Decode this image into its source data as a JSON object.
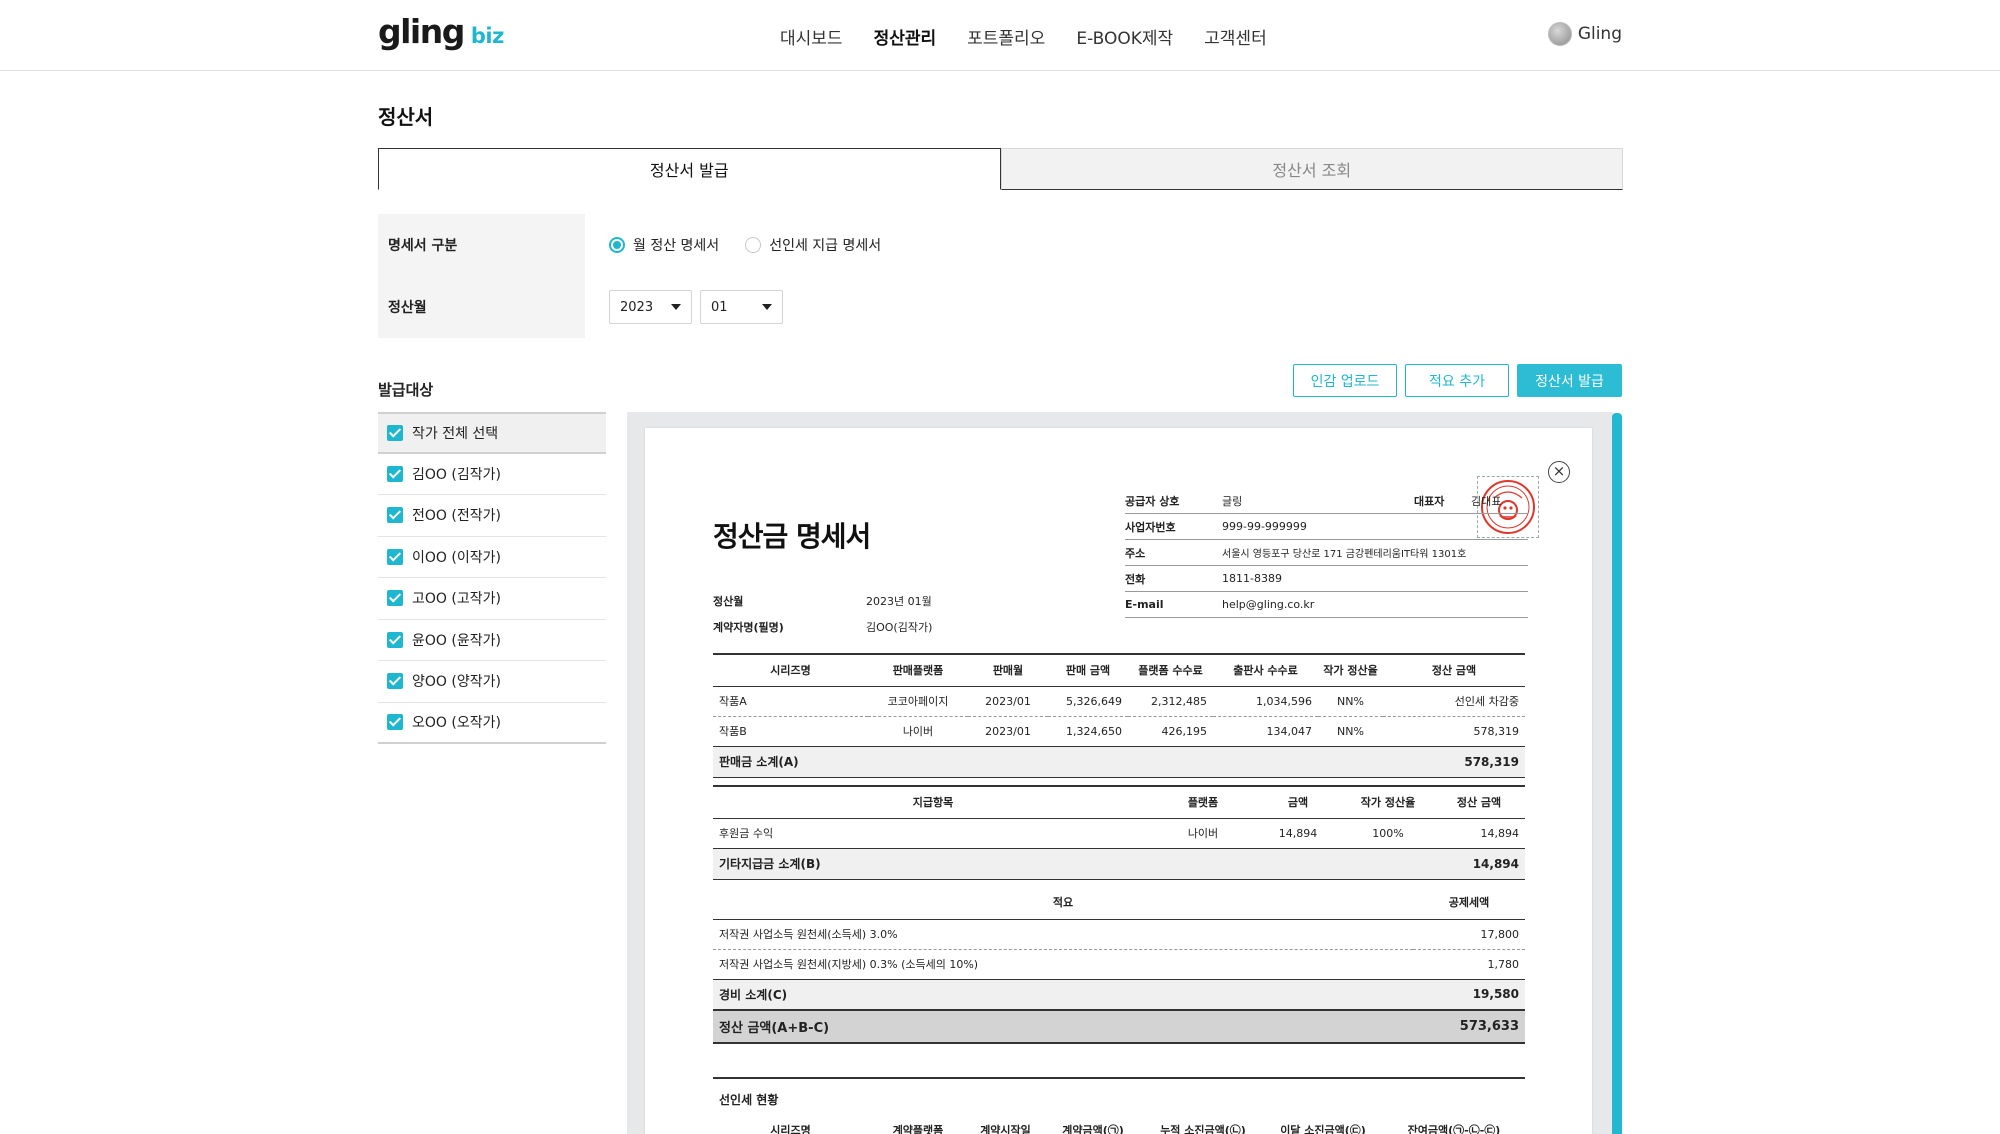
{
  "header": {
    "logo_main": "gling",
    "logo_sub": "biz",
    "nav": [
      "대시보드",
      "정산관리",
      "포트폴리오",
      "E-BOOK제작",
      "고객센터"
    ],
    "active_nav": "정산관리",
    "user_name": "Gling"
  },
  "page": {
    "title": "정산서",
    "tabs": [
      "정산서 발급",
      "정산서 조회"
    ],
    "active_tab": "정산서 발급"
  },
  "form": {
    "type_label": "명세서 구분",
    "type_options": [
      "월 정산 명세서",
      "선인세 지급 명세서"
    ],
    "type_selected": "월 정산 명세서",
    "month_label": "정산월",
    "year": "2023",
    "month": "01"
  },
  "targets": {
    "label": "발급대상",
    "select_all": "작가 전체 선택",
    "authors": [
      "김OO (김작가)",
      "전OO (전작가)",
      "이OO (이작가)",
      "고OO (고작가)",
      "윤OO (윤작가)",
      "양OO (양작가)",
      "오OO (오작가)"
    ]
  },
  "actions": {
    "upload_stamp": "인감 업로드",
    "add_note": "적요 추가",
    "issue": "정산서 발급"
  },
  "doc": {
    "title": "정산금 명세서",
    "supplier": {
      "name_label": "공급자 상호",
      "name": "글링",
      "ceo_label": "대표자",
      "ceo": "김대표",
      "biz_no_label": "사업자번호",
      "biz_no": "999-99-999999",
      "addr_label": "주소",
      "addr": "서울시 영등포구 당산로 171 금강펜테리움IT타워 1301호",
      "tel_label": "전화",
      "tel": "1811-8389",
      "email_label": "E-mail",
      "email": "help@gling.co.kr"
    },
    "meta": {
      "month_label": "정산월",
      "month": "2023년 01월",
      "contract_label": "계약자명(필명)",
      "contract": "김OO(김작가)"
    },
    "sales": {
      "headers": [
        "시리즈명",
        "판매플랫폼",
        "판매월",
        "판매 금액",
        "플랫폼 수수료",
        "출판사 수수료",
        "작가 정산율",
        "정산 금액"
      ],
      "rows": [
        [
          "작품A",
          "코코아페이지",
          "2023/01",
          "5,326,649",
          "2,312,485",
          "1,034,596",
          "NN%",
          "선인세 차감중"
        ],
        [
          "작품B",
          "나이버",
          "2023/01",
          "1,324,650",
          "426,195",
          "134,047",
          "NN%",
          "578,319"
        ]
      ],
      "subtotal_label": "판매금 소계(A)",
      "subtotal": "578,319"
    },
    "etc": {
      "headers": [
        "지급항목",
        "플랫폼",
        "금액",
        "작가 정산율",
        "정산 금액"
      ],
      "rows": [
        [
          "후원금 수익",
          "나이버",
          "14,894",
          "100%",
          "14,894"
        ]
      ],
      "subtotal_label": "기타지급금 소계(B)",
      "subtotal": "14,894"
    },
    "deduct": {
      "headers": [
        "적요",
        "공제세액"
      ],
      "rows": [
        [
          "저작권 사업소득 원천세(소득세) 3.0%",
          "17,800"
        ],
        [
          "저작권 사업소득 원천세(지방세) 0.3% (소득세의 10%)",
          "1,780"
        ]
      ],
      "subtotal_label": "경비 소계(C)",
      "subtotal": "19,580"
    },
    "total_label": "정산 금액(A+B-C)",
    "total": "573,633",
    "advance": {
      "title": "선인세 현황",
      "headers": [
        "시리즈명",
        "계약플랫폼",
        "계약시작일",
        "계약금액(㉠)",
        "누적 소진금액(㉡)",
        "이달 소진금액(㉢)",
        "잔여금액(㉠-㉡-㉢)"
      ]
    }
  },
  "colors": {
    "accent": "#1fb7cf",
    "primary_button": "#2cbdd4"
  }
}
